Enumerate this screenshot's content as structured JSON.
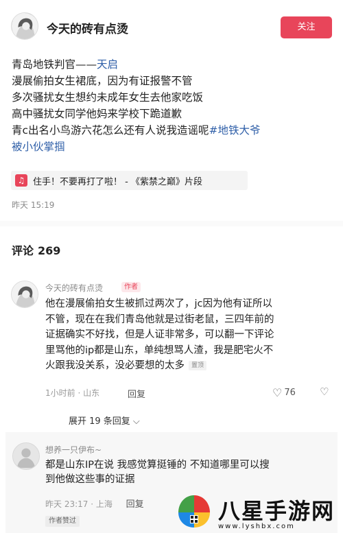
{
  "header": {
    "author_name": "今天的砖有点烫",
    "follow_label": "关注"
  },
  "post": {
    "lines": [
      {
        "pre": "青岛地铁判官——",
        "link": "天启"
      },
      {
        "text": "漫展偷拍女生裙底，因为有证报警不管"
      },
      {
        "text": "多次骚扰女生想约未成年女生去他家吃饭"
      },
      {
        "text": "高中骚扰女同学他妈来学校下跪道歉"
      },
      {
        "pre": "青c出名小鸟游六花怎么还有人说我造谣呢",
        "hashtag": "#地铁大爷"
      },
      {
        "hashtag": "被小伙掌掴"
      }
    ],
    "music": {
      "icon": "music-note-icon",
      "text": "住手！不要再打了啦！ - 《紫禁之巅》片段"
    },
    "time": "昨天 15:19"
  },
  "comments": {
    "title": "评论",
    "count": "269",
    "top_comment": {
      "author": "今天的砖有点烫",
      "author_tag": "作者",
      "lines": [
        "他在漫展偷拍女生被抓过两次了，jc因为他有证所以",
        "不管，现在在我们青岛他就是过街老鼠，三四年前的",
        "证据确实不好找，但是人证非常多，可以翻一下评论",
        "里骂他的ip都是山东，单纯想骂人渣，我是肥宅火不",
        "火跟我没关系，没必要想的太多"
      ],
      "pinned_label": "置顶",
      "meta": "1小时前 · 山东",
      "reply_label": "回复",
      "likes": "76",
      "expand_label": "展开 19 条回复"
    },
    "reply": {
      "author": "想养一只伊布~",
      "lines": [
        "都是山东IP在说 我感觉算挺锤的 不知道哪里可以搜",
        "到他做这些事的证据"
      ],
      "meta": "昨天 23:17 · 上海",
      "reply_label": "回复",
      "liked_tag": "作者赞过"
    }
  },
  "watermark": {
    "title": "八星手游网",
    "url": "www.lyshbx.com"
  },
  "colors": {
    "accent": "#e8455a",
    "link": "#2f5fa8",
    "muted": "#8a8a8a"
  }
}
